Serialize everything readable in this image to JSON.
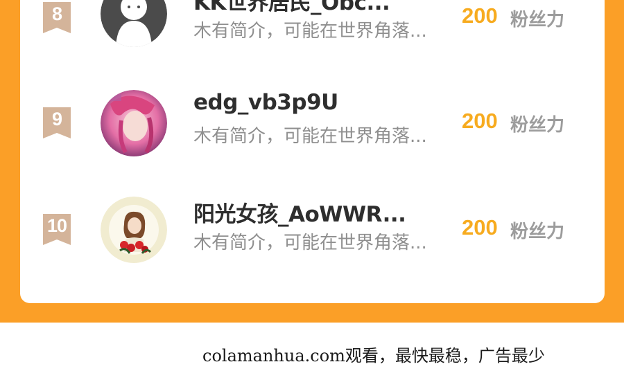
{
  "colors": {
    "background_orange": "#fb9f27",
    "rank_badge": "#d4b49a",
    "score": "#f7ab1f",
    "name": "#2e2e2e",
    "bio": "#8f8f8f"
  },
  "ranking": [
    {
      "rank": "8",
      "name": "KK世界居民_Obc...",
      "bio": "木有简介，可能在世界角落...",
      "score": "200",
      "score_label": "粉丝力",
      "avatar_icon": "default-user-avatar-icon"
    },
    {
      "rank": "9",
      "name": "edg_vb3p9U",
      "bio": "木有简介，可能在世界角落...",
      "score": "200",
      "score_label": "粉丝力",
      "avatar_icon": "pink-hair-character-avatar-icon"
    },
    {
      "rank": "10",
      "name": "阳光女孩_AoWWR...",
      "bio": "木有简介，可能在世界角落...",
      "score": "200",
      "score_label": "粉丝力",
      "avatar_icon": "girl-with-roses-avatar-icon"
    }
  ],
  "watermark": "colamanhua.com观看，最快最稳，广告最少"
}
